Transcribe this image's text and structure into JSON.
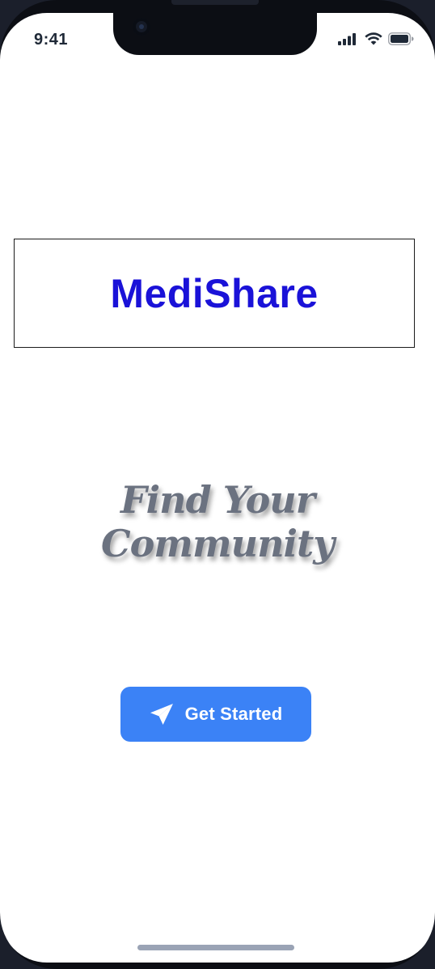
{
  "status_bar": {
    "time": "9:41",
    "icons": [
      "signal-icon",
      "wifi-icon",
      "battery-icon"
    ]
  },
  "app": {
    "name": "MediShare",
    "brand_color": "#1a12d8"
  },
  "tagline": {
    "text": "Find Your Community",
    "color": "#6b7280"
  },
  "cta": {
    "label": "Get Started",
    "icon": "send-icon",
    "color": "#3b82f6"
  }
}
